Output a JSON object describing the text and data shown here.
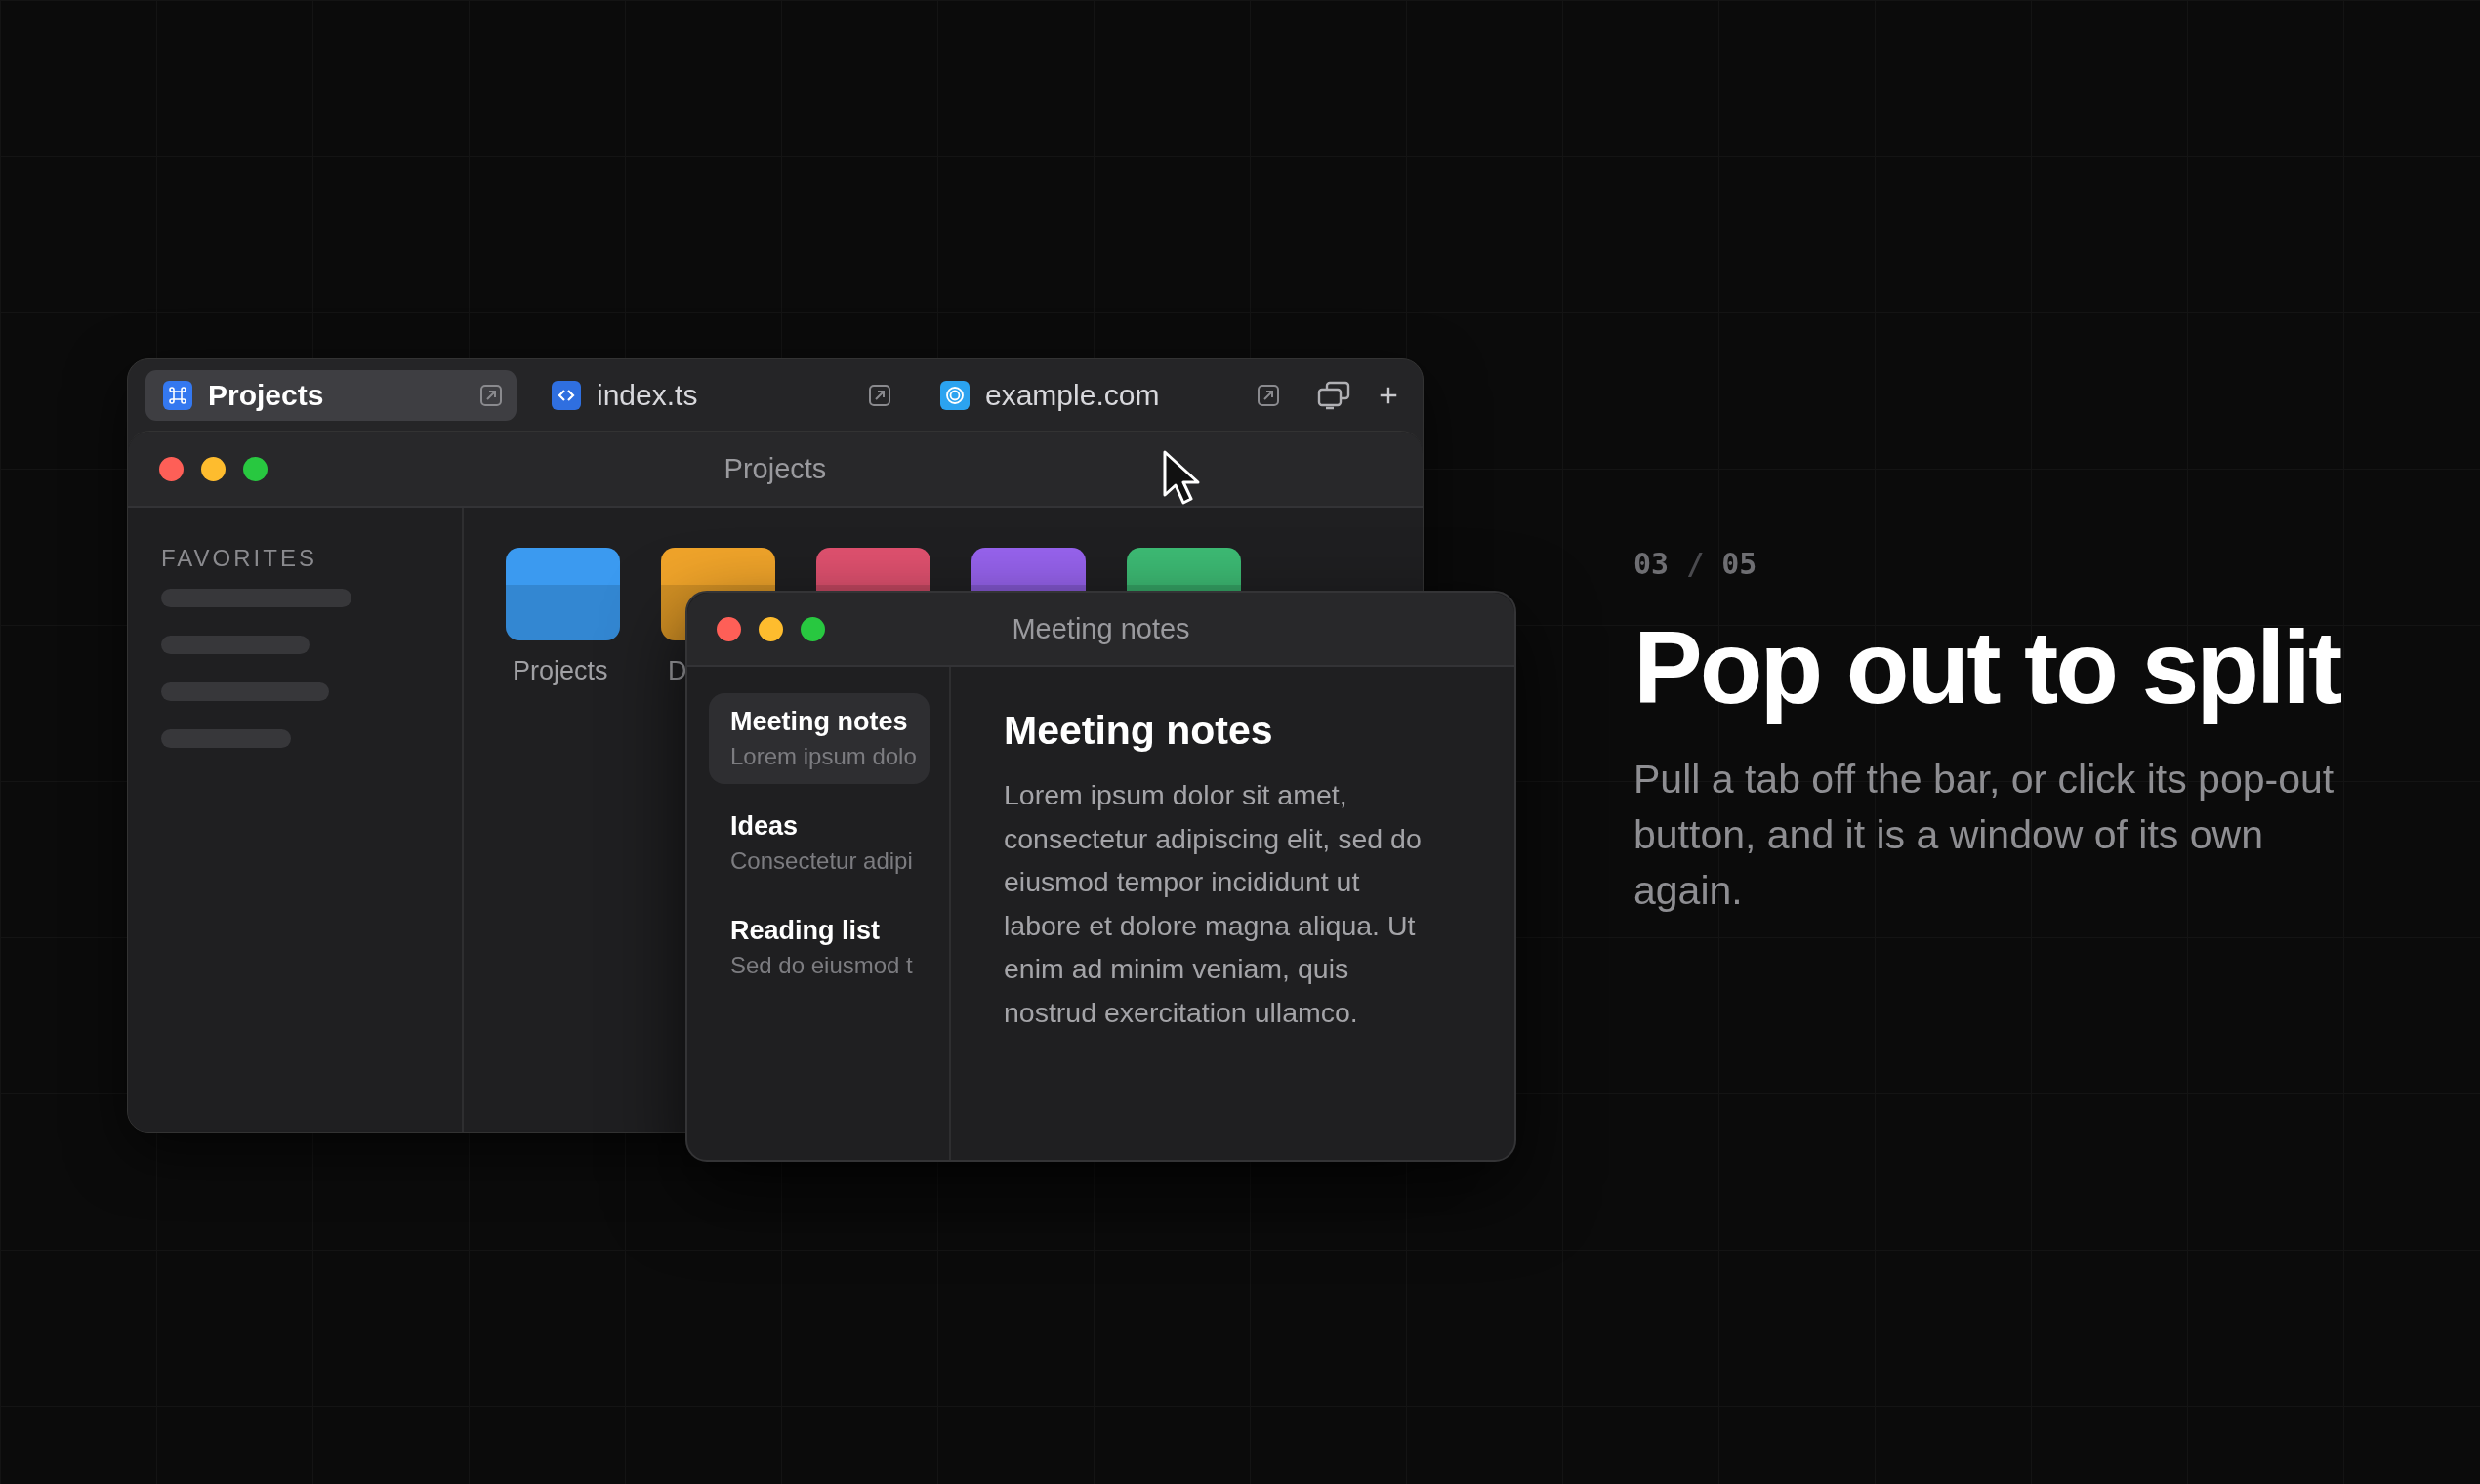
{
  "main_window": {
    "tabs": [
      {
        "label": "Projects",
        "kind": "command",
        "selected": true
      },
      {
        "label": "index.ts",
        "kind": "code",
        "selected": false
      },
      {
        "label": "example.com",
        "kind": "rings",
        "selected": false
      }
    ],
    "title": "Projects",
    "sidebar": {
      "heading": "FAVORITES"
    },
    "folders": [
      {
        "label": "Projects",
        "color": "#3b9af0"
      },
      {
        "label": "D",
        "color": "#f0a42a"
      },
      {
        "color": "#e0516f"
      },
      {
        "color": "#9763ee"
      },
      {
        "color": "#3dbb74"
      }
    ]
  },
  "notes_window": {
    "title": "Meeting notes",
    "notes": [
      {
        "title": "Meeting notes",
        "preview": "Lorem ipsum dolo",
        "selected": true
      },
      {
        "title": "Ideas",
        "preview": "Consectetur adipi",
        "selected": false
      },
      {
        "title": "Reading list",
        "preview": "Sed do eiusmod t",
        "selected": false
      }
    ],
    "heading": "Meeting notes",
    "body": "Lorem ipsum dolor sit amet, consectetur adipiscing elit, sed do eiusmod tempor incididunt ut labore et dolore magna aliqua. Ut enim ad minim veniam, quis nostrud exercitation ullamco."
  },
  "step": {
    "current": "03",
    "separator": "/",
    "total": "05"
  },
  "headline": "Pop out to split",
  "description": "Pull a tab off the bar, or click its pop-out button, and it is a window of its own again."
}
